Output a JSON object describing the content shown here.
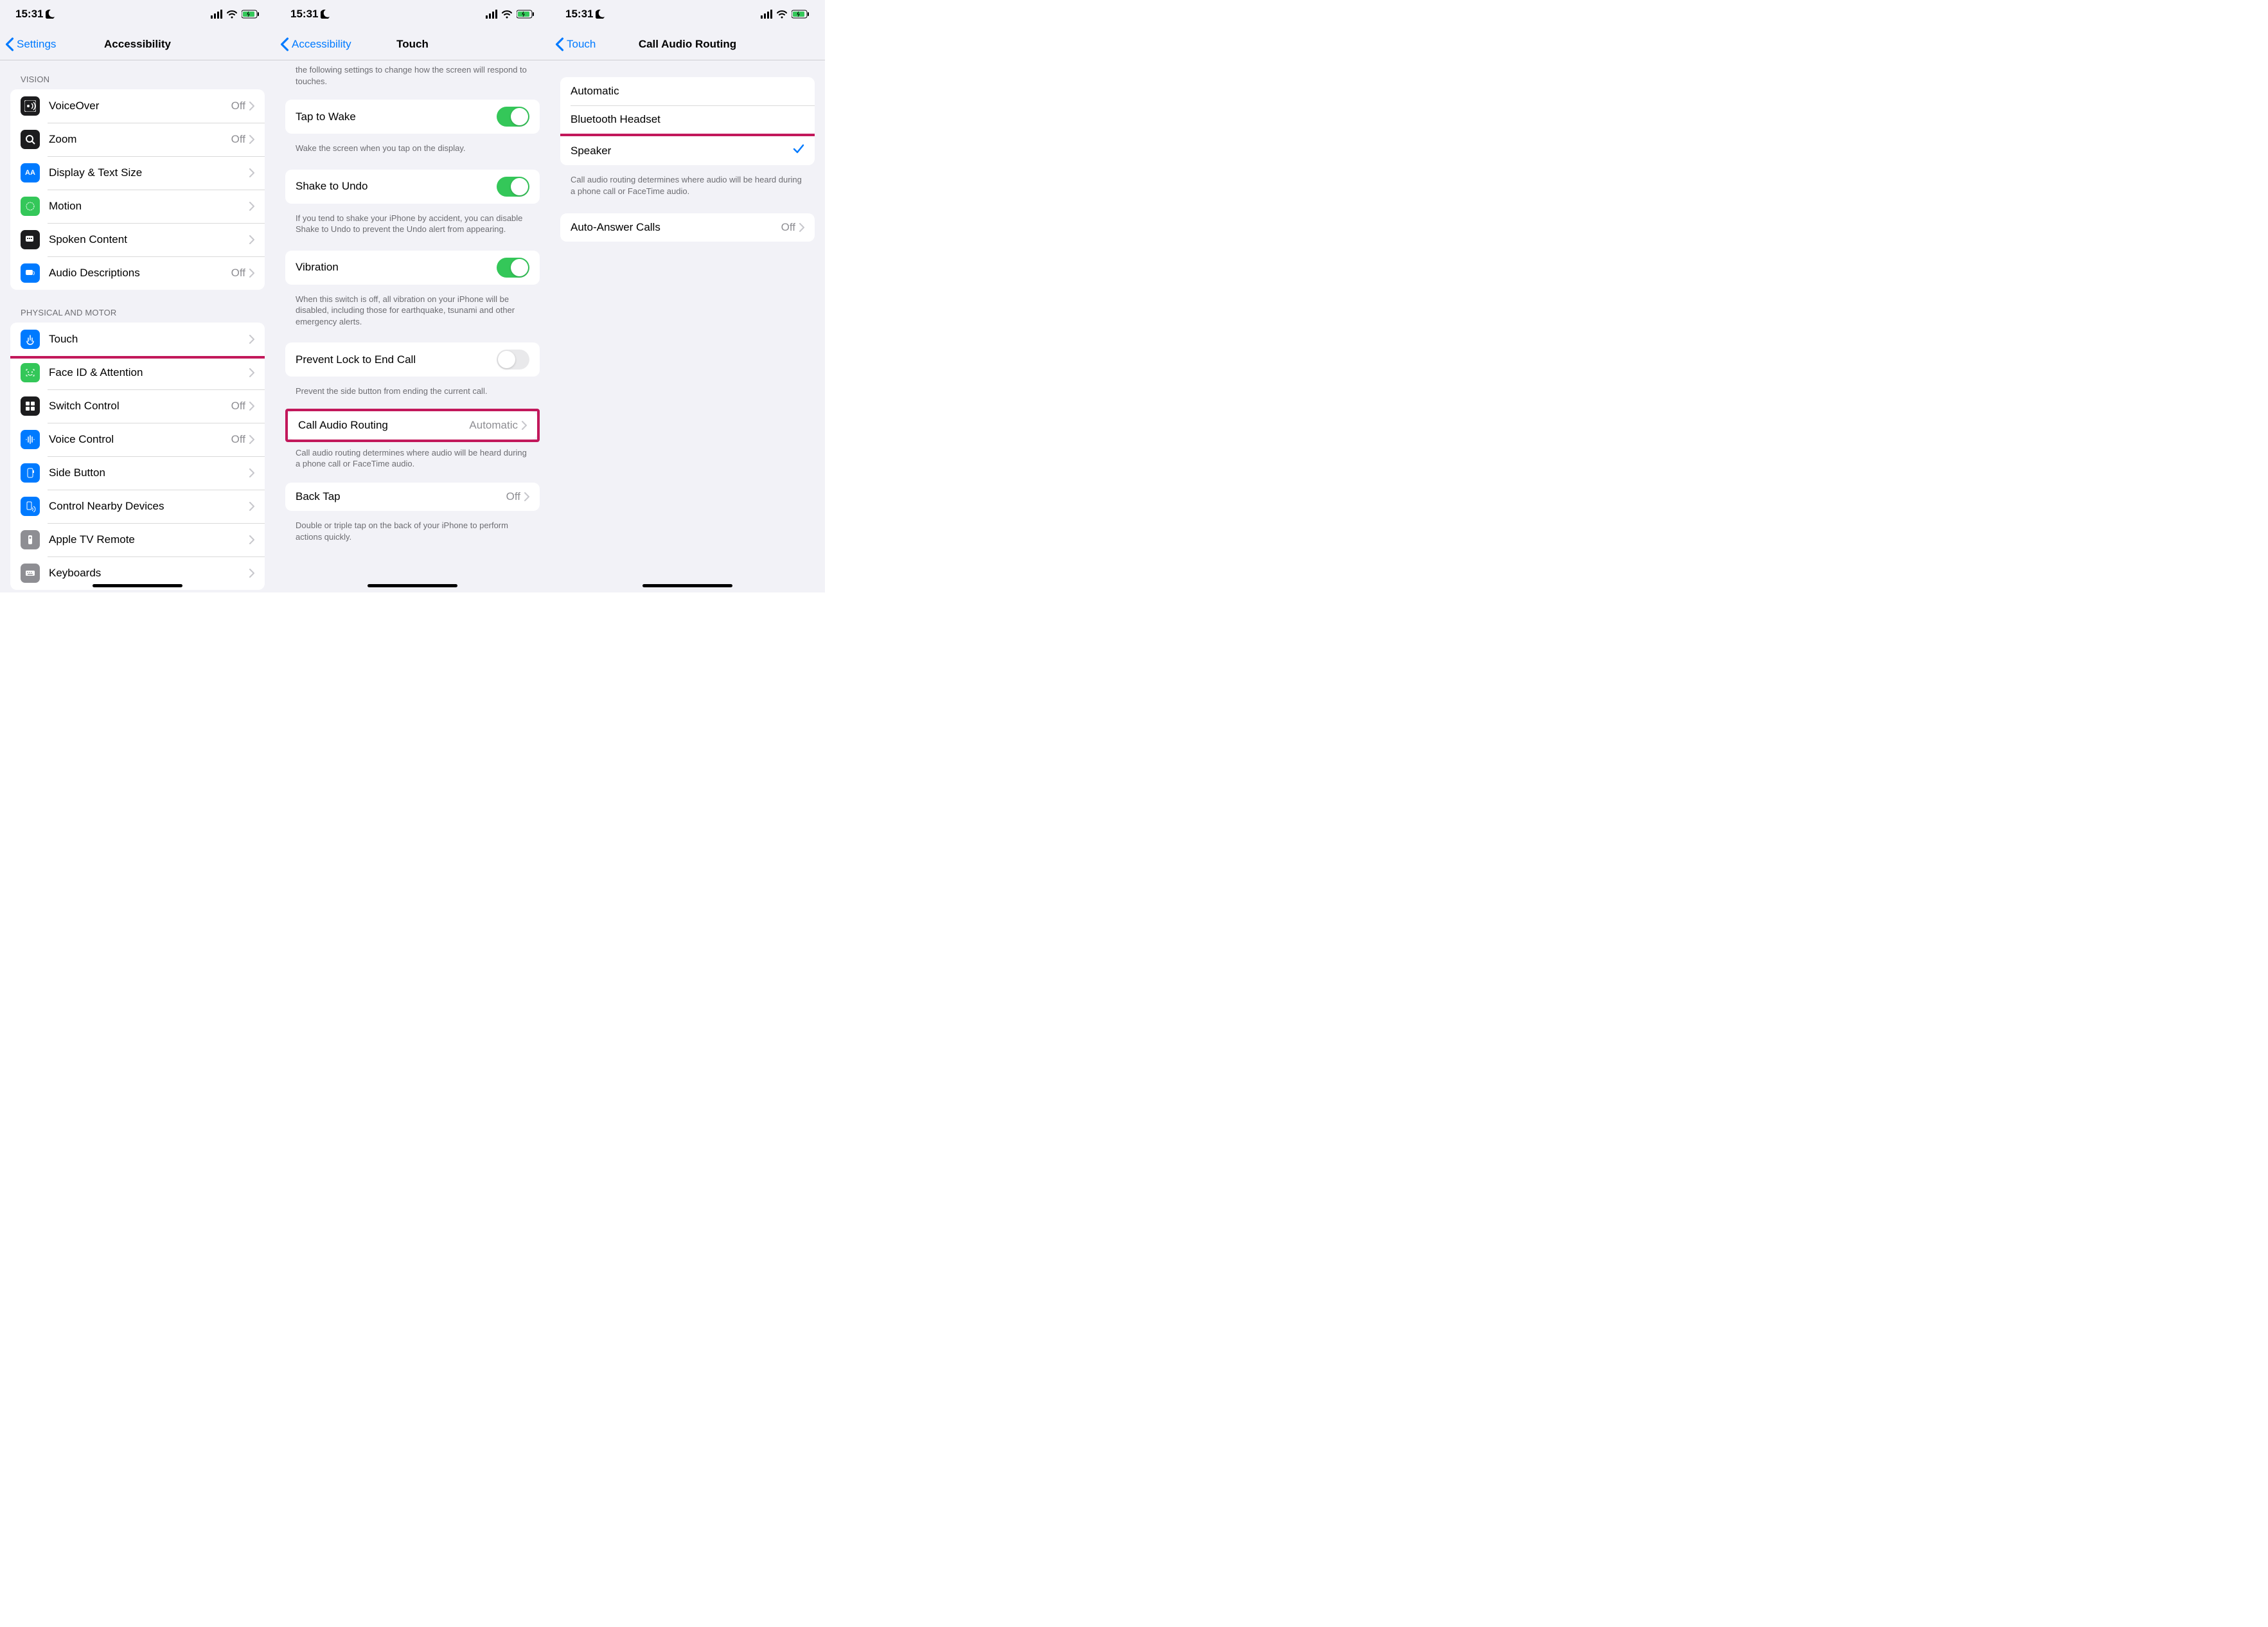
{
  "status": {
    "time": "15:31"
  },
  "screen1": {
    "back": "Settings",
    "title": "Accessibility",
    "section1_header": "VISION",
    "rows1": [
      {
        "label": "VoiceOver",
        "value": "Off"
      },
      {
        "label": "Zoom",
        "value": "Off"
      },
      {
        "label": "Display & Text Size"
      },
      {
        "label": "Motion"
      },
      {
        "label": "Spoken Content"
      },
      {
        "label": "Audio Descriptions",
        "value": "Off"
      }
    ],
    "section2_header": "PHYSICAL AND MOTOR",
    "rows2": [
      {
        "label": "Touch"
      },
      {
        "label": "Face ID & Attention"
      },
      {
        "label": "Switch Control",
        "value": "Off"
      },
      {
        "label": "Voice Control",
        "value": "Off"
      },
      {
        "label": "Side Button"
      },
      {
        "label": "Control Nearby Devices"
      },
      {
        "label": "Apple TV Remote"
      },
      {
        "label": "Keyboards"
      }
    ]
  },
  "screen2": {
    "back": "Accessibility",
    "title": "Touch",
    "intro_footer": "the following settings to change how the screen will respond to touches.",
    "tap_to_wake": "Tap to Wake",
    "tap_to_wake_footer": "Wake the screen when you tap on the display.",
    "shake_to_undo": "Shake to Undo",
    "shake_to_undo_footer": "If you tend to shake your iPhone by accident, you can disable Shake to Undo to prevent the Undo alert from appearing.",
    "vibration": "Vibration",
    "vibration_footer": "When this switch is off, all vibration on your iPhone will be disabled, including those for earthquake, tsunami and other emergency alerts.",
    "prevent_lock": "Prevent Lock to End Call",
    "prevent_lock_footer": "Prevent the side button from ending the current call.",
    "call_audio": "Call Audio Routing",
    "call_audio_value": "Automatic",
    "call_audio_footer": "Call audio routing determines where audio will be heard during a phone call or FaceTime audio.",
    "back_tap": "Back Tap",
    "back_tap_value": "Off",
    "back_tap_footer": "Double or triple tap on the back of your iPhone to perform actions quickly."
  },
  "screen3": {
    "back": "Touch",
    "title": "Call Audio Routing",
    "options": [
      {
        "label": "Automatic"
      },
      {
        "label": "Bluetooth Headset"
      },
      {
        "label": "Speaker",
        "selected": true
      }
    ],
    "footer": "Call audio routing determines where audio will be heard during a phone call or FaceTime audio.",
    "auto_answer": "Auto-Answer Calls",
    "auto_answer_value": "Off"
  }
}
